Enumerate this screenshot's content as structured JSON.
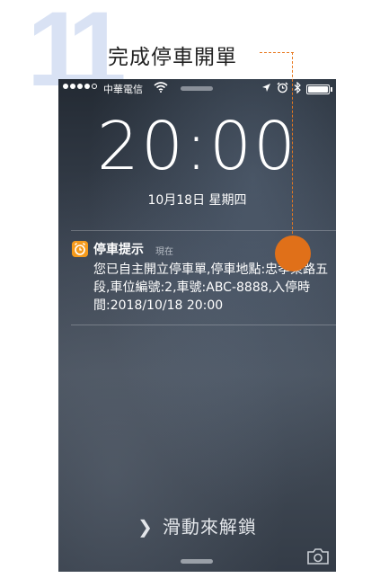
{
  "step": {
    "number": "11",
    "title": "完成停車開單"
  },
  "status_bar": {
    "carrier": "中華電信",
    "icons": [
      "signal-dots",
      "wifi-icon",
      "location-icon",
      "alarm-icon",
      "bluetooth-icon",
      "battery-icon"
    ]
  },
  "lock_screen": {
    "time": "20:00",
    "date": "10月18日 星期四",
    "unlock_text": "滑動來解鎖"
  },
  "notification": {
    "app_name": "停車提示",
    "time": "現在",
    "body": "您已自主開立停車單,停車地點:忠孝東路五段,車位編號:2,車號:ABC-8888,入停時間:2018/10/18 20:00"
  },
  "colors": {
    "accent": "#e07019",
    "step_number": "#d9e2f4",
    "notif_icon": "#f59a1b"
  }
}
